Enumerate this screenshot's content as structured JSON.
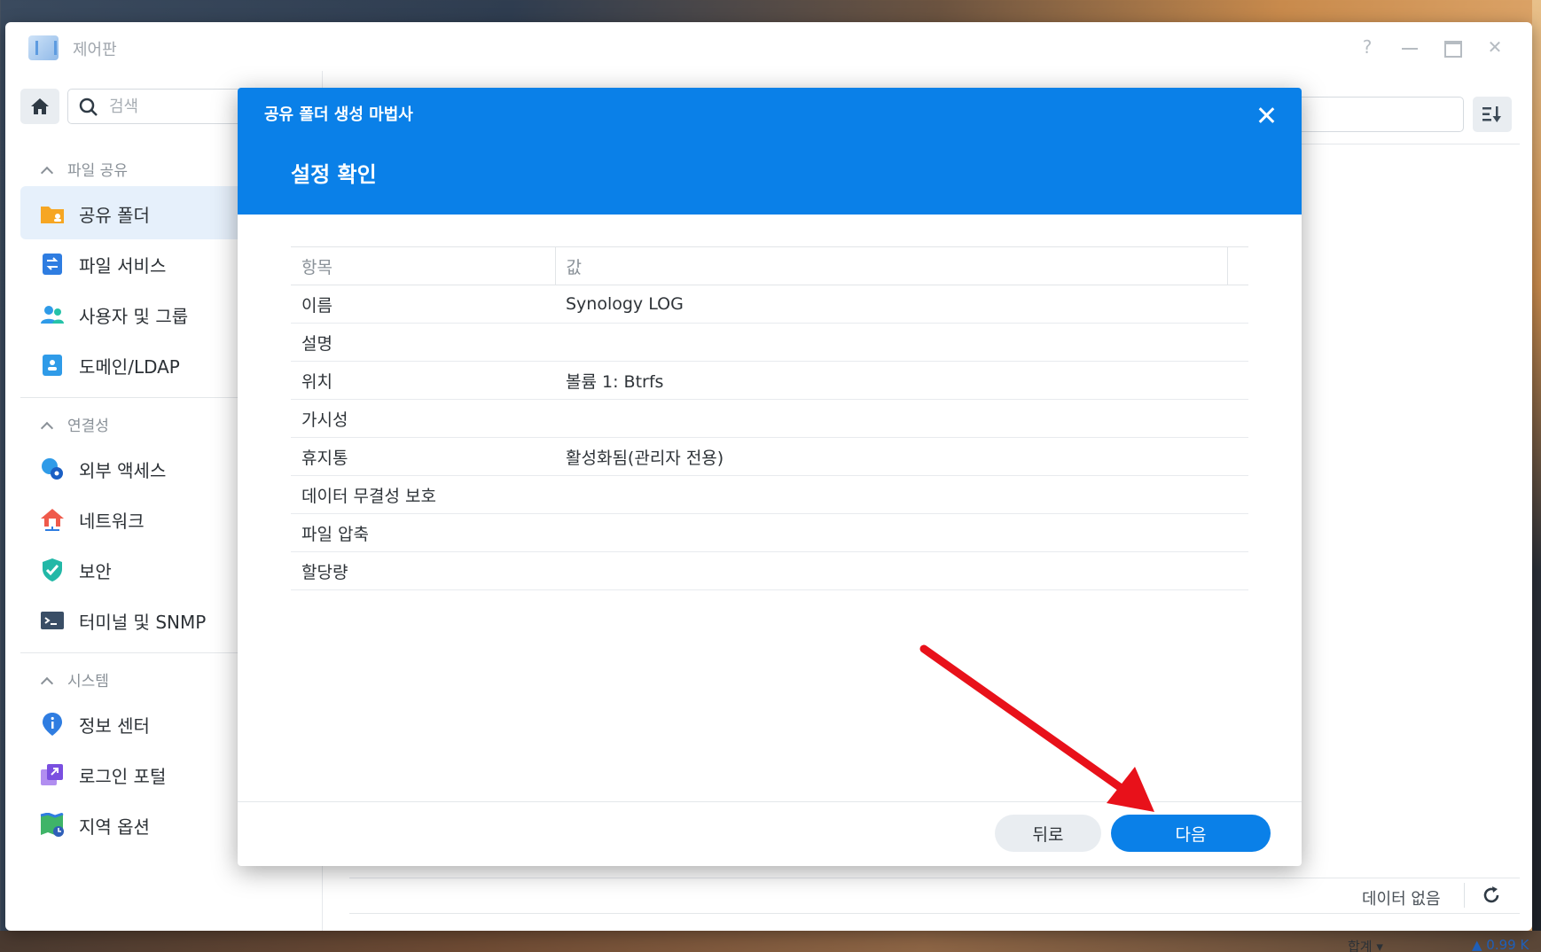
{
  "window": {
    "title": "제어판",
    "help_label": "?"
  },
  "sidebar": {
    "search_placeholder": "검색",
    "sections": [
      {
        "title": "파일 공유",
        "items": [
          {
            "label": "공유 폴더",
            "icon": "shared-folder-icon",
            "active": true
          },
          {
            "label": "파일 서비스",
            "icon": "file-services-icon"
          },
          {
            "label": "사용자 및 그룹",
            "icon": "user-group-icon"
          },
          {
            "label": "도메인/LDAP",
            "icon": "domain-ldap-icon"
          }
        ]
      },
      {
        "title": "연결성",
        "items": [
          {
            "label": "외부 액세스",
            "icon": "external-access-icon"
          },
          {
            "label": "네트워크",
            "icon": "network-icon"
          },
          {
            "label": "보안",
            "icon": "security-shield-icon"
          },
          {
            "label": "터미널 및 SNMP",
            "icon": "terminal-icon"
          }
        ]
      },
      {
        "title": "시스템",
        "items": [
          {
            "label": "정보 센터",
            "icon": "info-center-icon"
          },
          {
            "label": "로그인 포털",
            "icon": "login-portal-icon"
          },
          {
            "label": "지역 옵션",
            "icon": "regional-options-icon"
          }
        ]
      }
    ]
  },
  "content": {
    "no_data": "데이터 없음"
  },
  "dialog": {
    "wizard_title": "공유 폴더 생성 마법사",
    "step_title": "설정 확인",
    "table": {
      "headers": [
        "항목",
        "값"
      ],
      "rows": [
        {
          "item": "이름",
          "value": "Synology LOG"
        },
        {
          "item": "설명",
          "value": ""
        },
        {
          "item": "위치",
          "value": "볼륨 1: Btrfs"
        },
        {
          "item": "가시성",
          "value": ""
        },
        {
          "item": "휴지통",
          "value": "활성화됨(관리자 전용)"
        },
        {
          "item": "데이터 무결성 보호",
          "value": ""
        },
        {
          "item": "파일 압축",
          "value": ""
        },
        {
          "item": "할당량",
          "value": ""
        }
      ]
    },
    "back_label": "뒤로",
    "next_label": "다음"
  },
  "colors": {
    "accent": "#0a80e8",
    "annotation_arrow": "#e8111a"
  },
  "bottom_strip": {
    "left": "합계 ▾",
    "right": "▲ 0.99 K"
  }
}
